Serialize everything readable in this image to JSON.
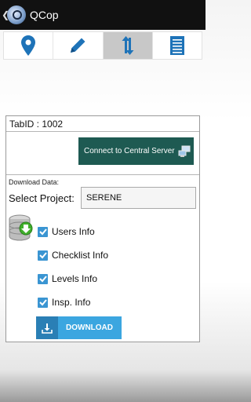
{
  "app": {
    "title": "QCop"
  },
  "tabs": [
    {
      "name": "location",
      "icon": "location-pin-icon"
    },
    {
      "name": "edit",
      "icon": "pencil-icon"
    },
    {
      "name": "sync",
      "icon": "sync-arrows-icon",
      "active": true
    },
    {
      "name": "list",
      "icon": "list-icon"
    }
  ],
  "tabid": {
    "text": "TabID :  1002"
  },
  "connect": {
    "label": "Connect to Central Server"
  },
  "download": {
    "heading": "Download Data:",
    "project_label": "Select Project:",
    "project_value": "SERENE",
    "options": [
      {
        "label": "Users Info",
        "checked": true
      },
      {
        "label": "Checklist Info",
        "checked": true
      },
      {
        "label": "Levels Info",
        "checked": true
      },
      {
        "label": "Insp. Info",
        "checked": true
      }
    ],
    "button_label": "DOWNLOAD"
  },
  "colors": {
    "accent": "#3ba6e0",
    "connect_button": "#1e5a52",
    "tab_icon": "#1e73b8"
  }
}
